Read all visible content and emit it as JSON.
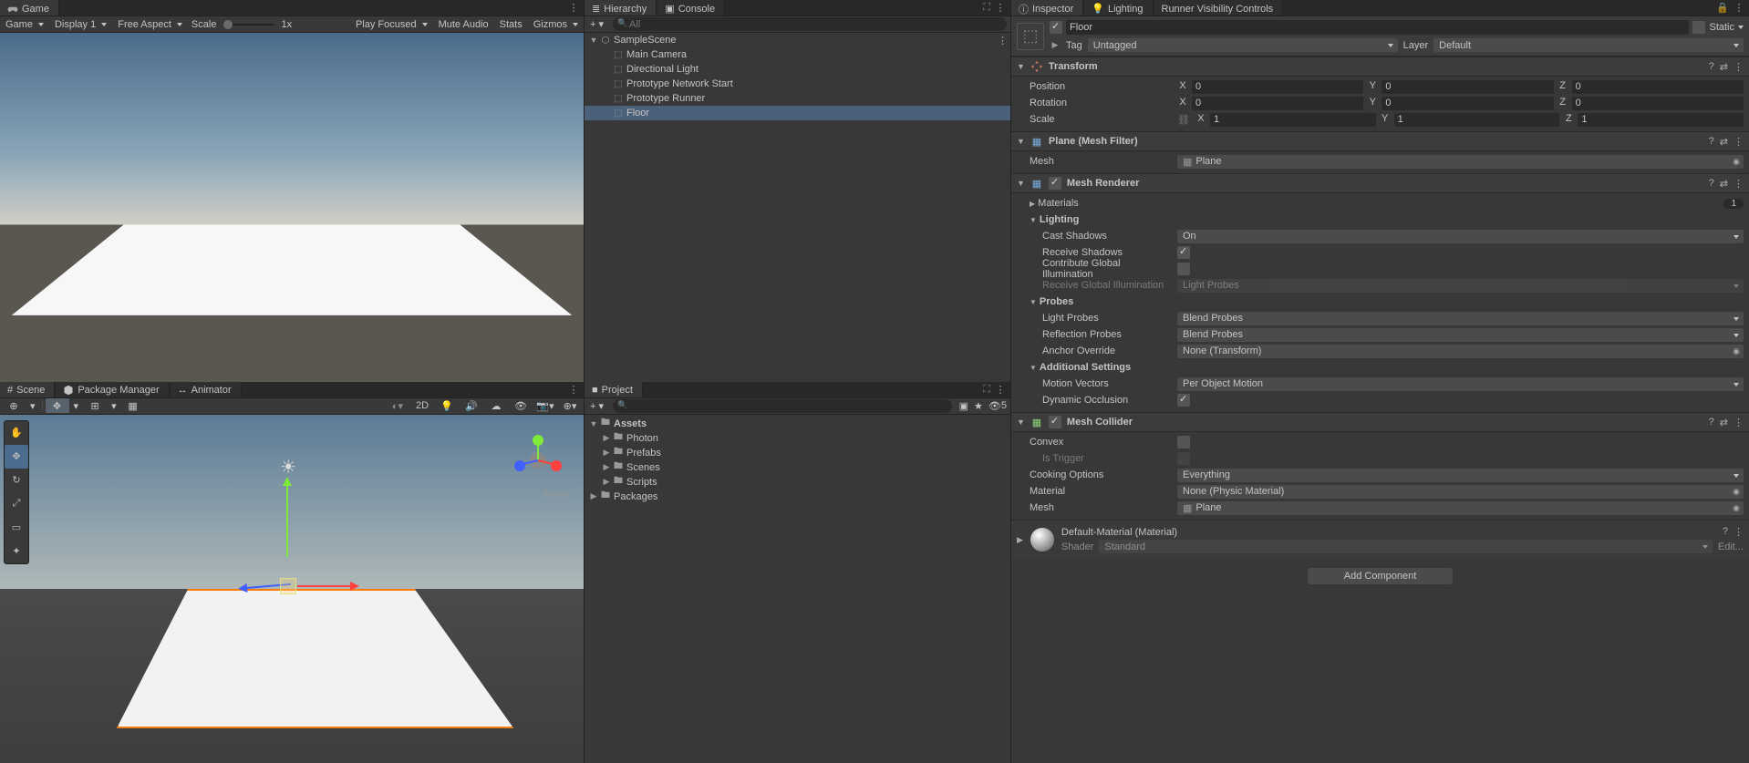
{
  "left_top": {
    "tab_game": "Game",
    "toolbar": {
      "game_dd": "Game",
      "display_dd": "Display 1",
      "aspect_dd": "Free Aspect",
      "scale_label": "Scale",
      "scale_val": "1x",
      "play_focused": "Play Focused",
      "mute": "Mute Audio",
      "stats": "Stats",
      "gizmos": "Gizmos"
    }
  },
  "left_bottom": {
    "tab_scene": "Scene",
    "tab_pm": "Package Manager",
    "tab_anim": "Animator",
    "toolbar": {
      "pivot": "Pivot",
      "global": "Global",
      "twod": "2D"
    },
    "persp": "Persp"
  },
  "mid_top": {
    "tab_hierarchy": "Hierarchy",
    "tab_console": "Console",
    "search_ph": "All",
    "scene_root": "SampleScene",
    "items": [
      "Main Camera",
      "Directional Light",
      "Prototype Network Start",
      "Prototype Runner",
      "Floor"
    ]
  },
  "mid_bottom": {
    "tab_project": "Project",
    "fav_count": "5",
    "tree": {
      "assets": "Assets",
      "assets_children": [
        "Photon",
        "Prefabs",
        "Scenes",
        "Scripts"
      ],
      "packages": "Packages"
    }
  },
  "right": {
    "tab_inspector": "Inspector",
    "tab_lighting": "Lighting",
    "tab_runner": "Runner Visibility Controls",
    "obj": {
      "name": "Floor",
      "static_label": "Static",
      "tag_label": "Tag",
      "tag_val": "Untagged",
      "layer_label": "Layer",
      "layer_val": "Default"
    },
    "transform": {
      "title": "Transform",
      "position": "Position",
      "rotation": "Rotation",
      "scale": "Scale",
      "p": {
        "x": "0",
        "y": "0",
        "z": "0"
      },
      "r": {
        "x": "0",
        "y": "0",
        "z": "0"
      },
      "s": {
        "x": "1",
        "y": "1",
        "z": "1"
      }
    },
    "meshfilter": {
      "title": "Plane (Mesh Filter)",
      "mesh_label": "Mesh",
      "mesh_val": "Plane"
    },
    "meshrenderer": {
      "title": "Mesh Renderer",
      "materials": "Materials",
      "materials_count": "1",
      "lighting_hdr": "Lighting",
      "cast_shadows": "Cast Shadows",
      "cast_shadows_val": "On",
      "receive_shadows": "Receive Shadows",
      "contribute_gi": "Contribute Global Illumination",
      "receive_gi": "Receive Global Illumination",
      "receive_gi_val": "Light Probes",
      "probes_hdr": "Probes",
      "light_probes": "Light Probes",
      "light_probes_val": "Blend Probes",
      "refl_probes": "Reflection Probes",
      "refl_probes_val": "Blend Probes",
      "anchor": "Anchor Override",
      "anchor_val": "None (Transform)",
      "addl_hdr": "Additional Settings",
      "motion": "Motion Vectors",
      "motion_val": "Per Object Motion",
      "dyn_occ": "Dynamic Occlusion"
    },
    "meshcollider": {
      "title": "Mesh Collider",
      "convex": "Convex",
      "is_trigger": "Is Trigger",
      "cooking": "Cooking Options",
      "cooking_val": "Everything",
      "material": "Material",
      "material_val": "None (Physic Material)",
      "mesh": "Mesh",
      "mesh_val": "Plane"
    },
    "material_strip": {
      "name": "Default-Material (Material)",
      "shader_label": "Shader",
      "shader_val": "Standard",
      "edit": "Edit..."
    },
    "add_component": "Add Component"
  }
}
